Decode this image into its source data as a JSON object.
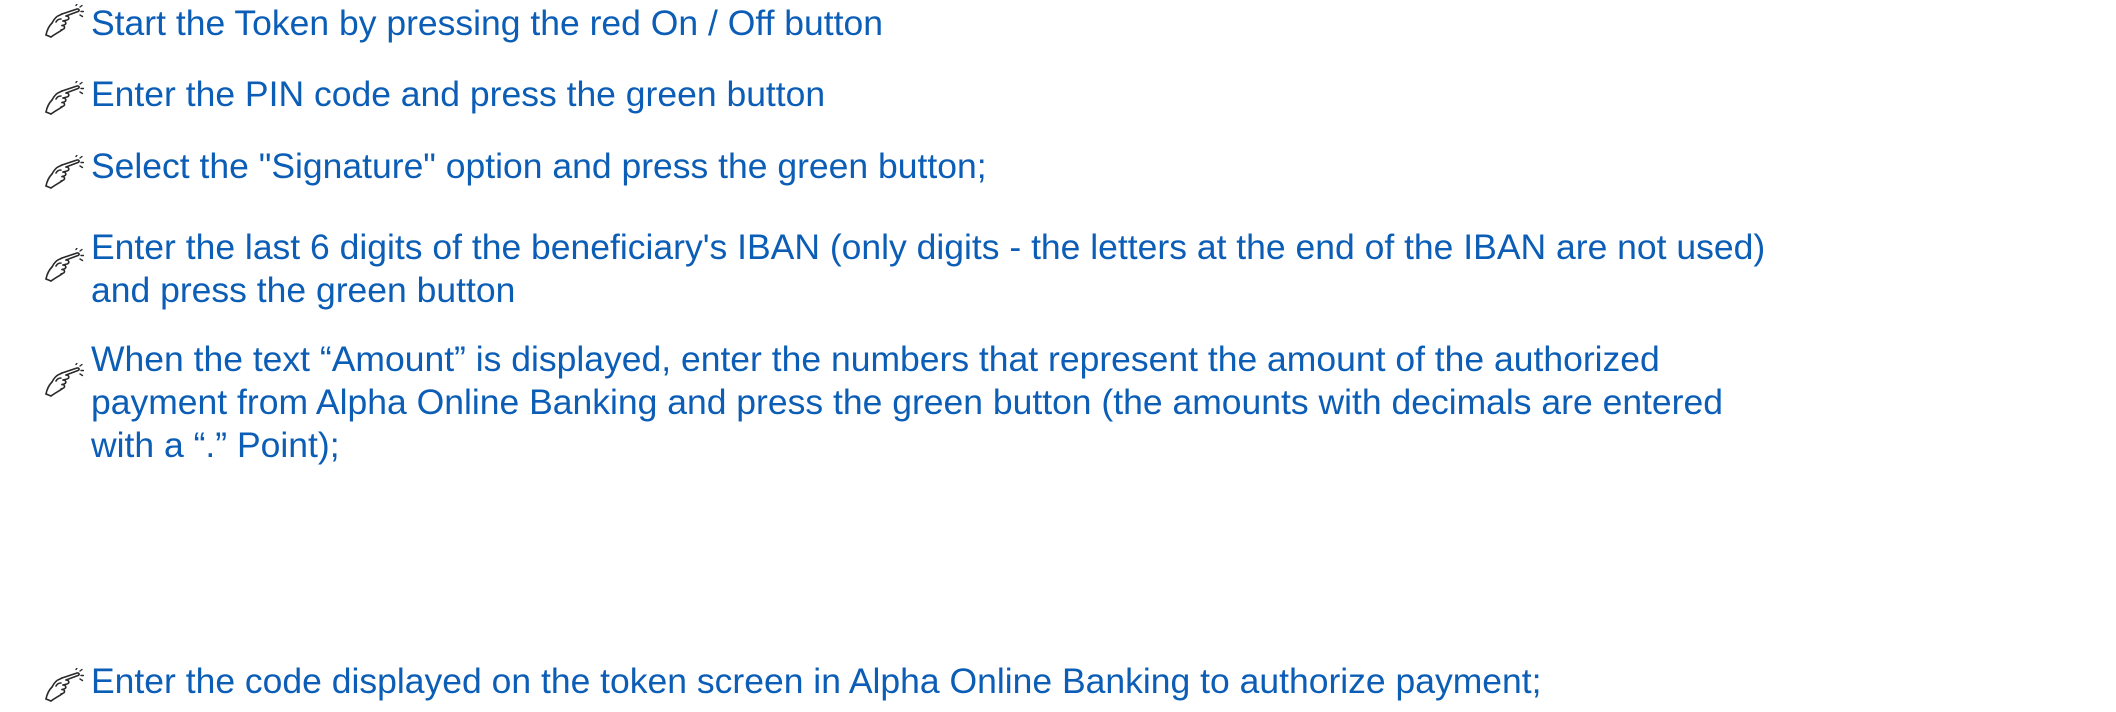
{
  "colors": {
    "text": "#0b5db6",
    "icon": "#2a2a2a"
  },
  "steps": [
    {
      "icon": "pointing-hand-icon",
      "lines": [
        "Start the Token by pressing the red On / Off button"
      ]
    },
    {
      "icon": "pointing-hand-icon",
      "lines": [
        "Enter the PIN code and press the green button"
      ]
    },
    {
      "icon": "pointing-hand-icon",
      "lines": [
        "Select the \"Signature\" option and press the green button;"
      ]
    },
    {
      "icon": "pointing-hand-icon",
      "lines": [
        "Enter the last 6 digits of the beneficiary's IBAN (only digits - the letters at the end of the IBAN are not used)",
        "and press the green button"
      ]
    },
    {
      "icon": "pointing-hand-icon",
      "lines": [
        "When the text “Amount” is displayed, enter the numbers that represent the amount of the authorized",
        "payment from Alpha Online Banking and press the green button (the amounts with decimals are entered",
        "with a “.” Point);"
      ]
    },
    {
      "icon": "pointing-hand-icon",
      "lines": [
        "Enter the code displayed on the token screen in Alpha Online Banking to authorize payment;"
      ]
    }
  ]
}
